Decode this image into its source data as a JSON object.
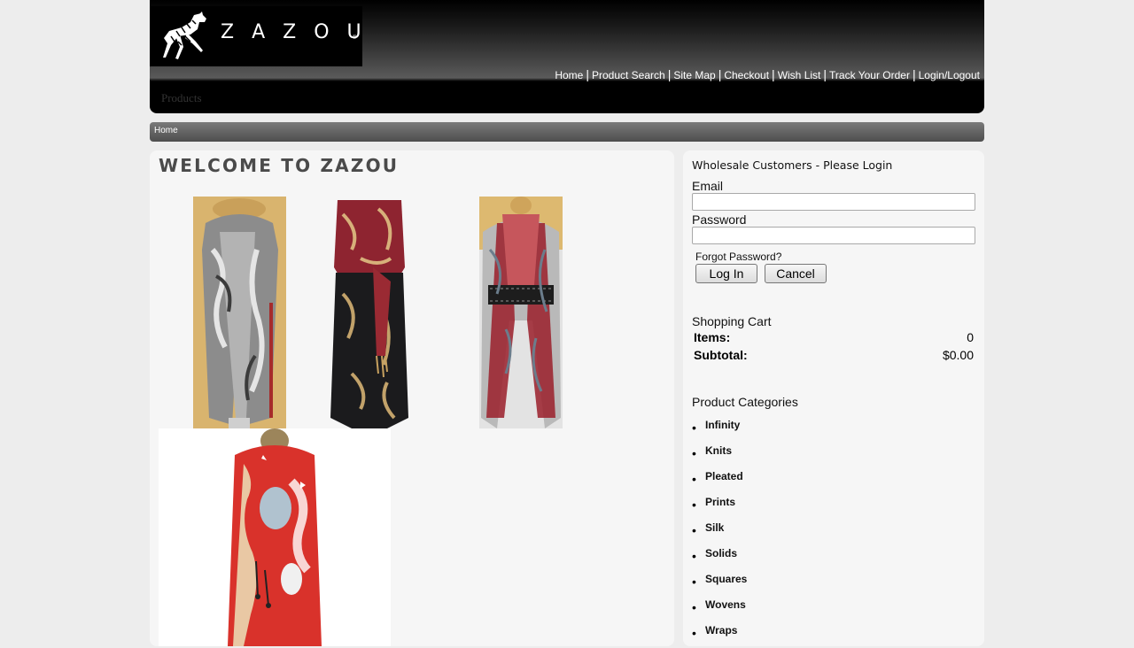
{
  "brand": {
    "logo_text": "ZAZOU",
    "reg_mark": "®"
  },
  "top_nav": [
    "Home",
    "Product Search",
    "Site Map",
    "Checkout",
    "Wish List",
    "Track Your Order",
    "Login/Logout"
  ],
  "nav_tab": "Products",
  "breadcrumb": "Home",
  "main": {
    "title": "WELCOME TO ZAZOU"
  },
  "login": {
    "title": "Wholesale Customers - Please Login",
    "email_label": "Email",
    "email_value": "",
    "password_label": "Password",
    "password_value": "",
    "forgot": "Forgot Password?",
    "login_button": "Log In",
    "cancel_button": "Cancel"
  },
  "cart": {
    "title": "Shopping Cart",
    "items_label": "Items:",
    "items_value": "0",
    "subtotal_label": "Subtotal:",
    "subtotal_value": "$0.00"
  },
  "categories": {
    "title": "Product Categories",
    "items": [
      "Infinity",
      "Knits",
      "Pleated",
      "Prints",
      "Silk",
      "Solids",
      "Squares",
      "Wovens",
      "Wraps"
    ]
  },
  "colors": {
    "panel": "#f6f6f6",
    "page_bg": "#ededed",
    "header": "#000000"
  }
}
